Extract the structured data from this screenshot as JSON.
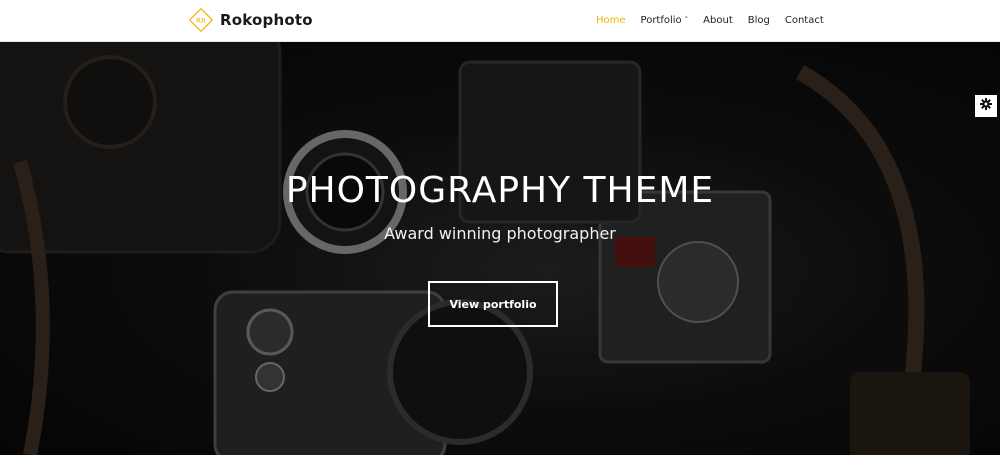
{
  "header": {
    "brand_name": "Rokophoto",
    "brand_logo_icon": "diamond-logo-icon",
    "accent_color": "#f0b400",
    "nav": [
      {
        "label": "Home",
        "active": true
      },
      {
        "label": "Portfolio",
        "has_dropdown": true
      },
      {
        "label": "About"
      },
      {
        "label": "Blog"
      },
      {
        "label": "Contact"
      }
    ]
  },
  "hero": {
    "title": "PHOTOGRAPHY THEME",
    "subtitle": "Award winning photographer",
    "button_label": "View portfolio",
    "background": "dark-cameras-photo"
  },
  "settings": {
    "icon": "gear-icon"
  }
}
